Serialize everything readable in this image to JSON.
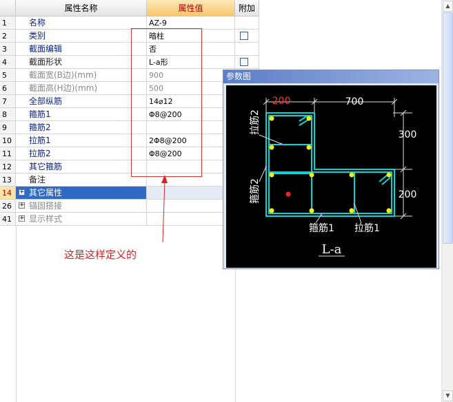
{
  "header": {
    "name_col": "属性名称",
    "value_col": "属性值",
    "extra_col": "附加"
  },
  "rows": [
    {
      "num": "1",
      "name": "名称",
      "value": "AZ-9",
      "checkbox": false
    },
    {
      "num": "2",
      "name": "类别",
      "value": "暗柱",
      "checkbox": true
    },
    {
      "num": "3",
      "name": "截面编辑",
      "value": "否",
      "checkbox": false
    },
    {
      "num": "4",
      "name": "截面形状",
      "value": "L-a形",
      "checkbox": true
    },
    {
      "num": "5",
      "name": "截面宽(B边)(mm)",
      "value": "900",
      "checkbox": false
    },
    {
      "num": "6",
      "name": "截面高(H边)(mm)",
      "value": "500",
      "checkbox": false
    },
    {
      "num": "7",
      "name": "全部纵筋",
      "value": "14⌀12",
      "checkbox": false
    },
    {
      "num": "8",
      "name": "箍筋1",
      "value": "Φ8@200",
      "checkbox": false
    },
    {
      "num": "9",
      "name": "箍筋2",
      "value": "",
      "checkbox": false
    },
    {
      "num": "10",
      "name": "拉筋1",
      "value": "2Φ8@200",
      "checkbox": false
    },
    {
      "num": "11",
      "name": "拉筋2",
      "value": "Φ8@200",
      "checkbox": false
    },
    {
      "num": "12",
      "name": "其它箍筋",
      "value": "",
      "checkbox": false
    },
    {
      "num": "13",
      "name": "备注",
      "value": "",
      "checkbox": false
    }
  ],
  "groups": [
    {
      "num": "14",
      "name": "其它属性",
      "selected": true
    },
    {
      "num": "26",
      "name": "锚固搭接",
      "selected": false
    },
    {
      "num": "41",
      "name": "显示样式",
      "selected": false
    }
  ],
  "annotation": {
    "text": "这是这样定义的"
  },
  "panel": {
    "title": "参数图",
    "dims": {
      "top_left": "200",
      "top_right": "700",
      "right_upper": "300",
      "right_lower": "200"
    },
    "labels": {
      "lajin2": "拉筋2",
      "gujin2": "箍筋2",
      "gujin1": "箍筋1",
      "lajin1": "拉筋1",
      "shape": "L-a"
    }
  },
  "colors": {
    "accent_blue": "#2f6ac8",
    "outline": "#00d8d8",
    "rebar": "#ffee00",
    "dim_red": "#e02020"
  }
}
